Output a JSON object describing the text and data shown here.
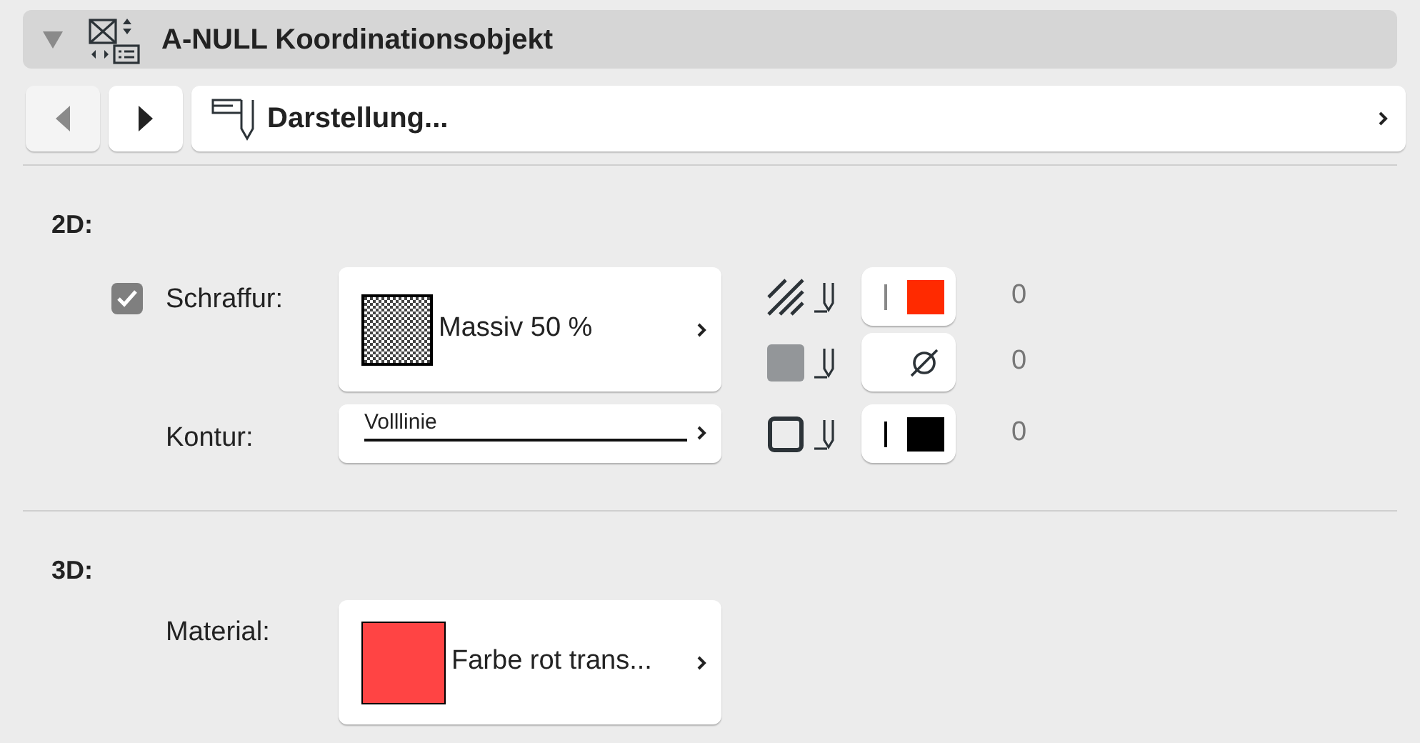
{
  "panel": {
    "title": "A-NULL Koordinationsobjekt",
    "expanded": true
  },
  "nav": {
    "label": "Darstellung..."
  },
  "section_2d": {
    "heading": "2D:",
    "fill": {
      "label": "Schraffur:",
      "checked": true,
      "value": "Massiv 50 %"
    },
    "contour": {
      "label": "Kontur:",
      "value": "Volllinie"
    },
    "pens": [
      {
        "kind": "hatch",
        "swatch": {
          "kind": "color",
          "color": "#ff2a00"
        },
        "number": "0"
      },
      {
        "kind": "background",
        "swatch": {
          "kind": "none"
        },
        "number": "0"
      },
      {
        "kind": "contour",
        "swatch": {
          "kind": "color",
          "color": "#000000"
        },
        "number": "0"
      }
    ]
  },
  "section_3d": {
    "heading": "3D:",
    "material": {
      "label": "Material:",
      "value": "Farbe rot trans...",
      "color": "#ff4444"
    }
  }
}
